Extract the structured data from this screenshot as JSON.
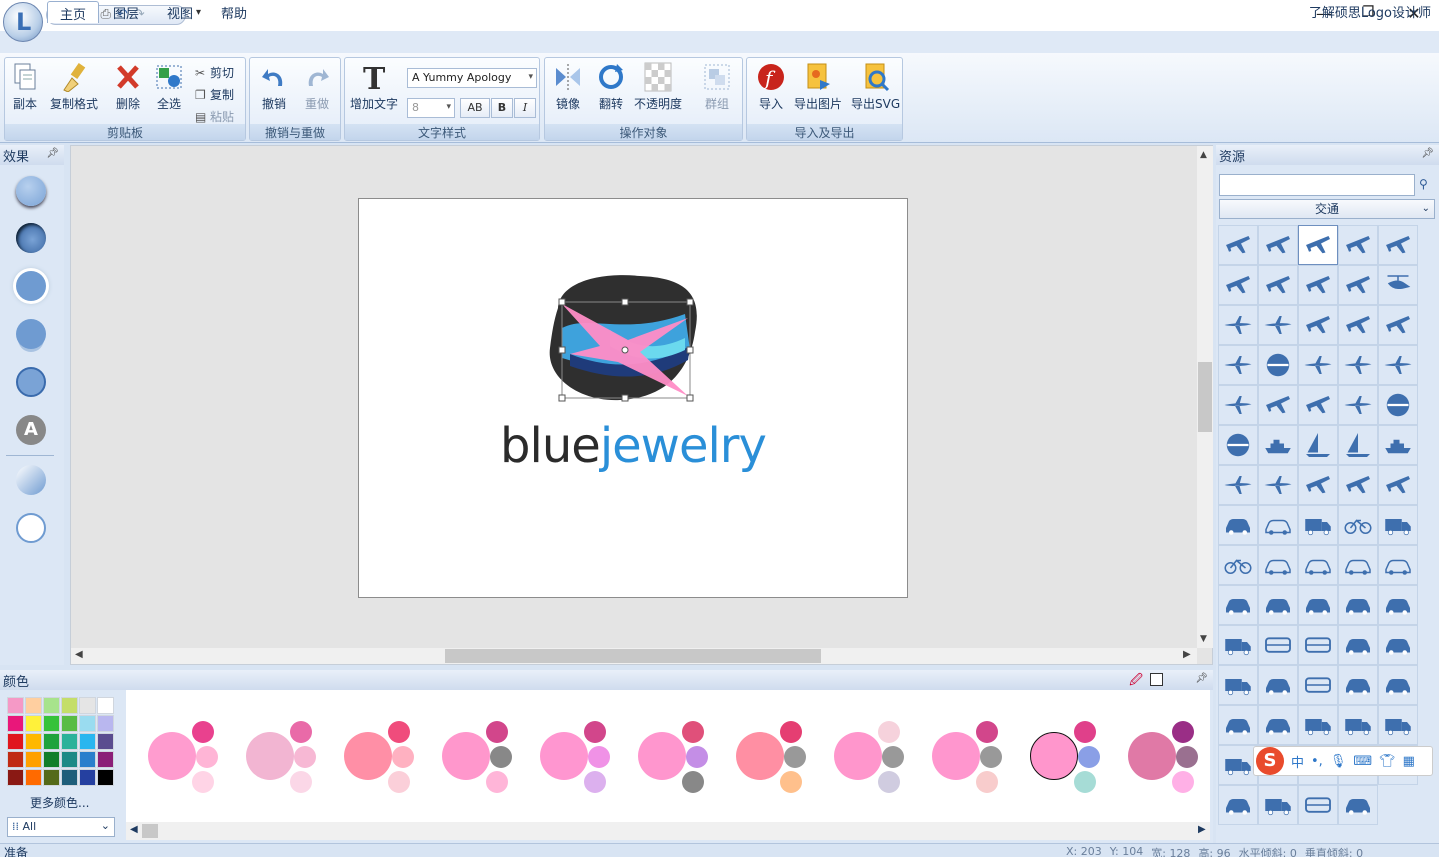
{
  "app": {
    "about_link": "了解硕思Logo设计师"
  },
  "tabs": [
    {
      "label": "主页",
      "active": true
    },
    {
      "label": "图层",
      "active": false
    },
    {
      "label": "视图",
      "active": false
    },
    {
      "label": "帮助",
      "active": false
    }
  ],
  "ribbon": {
    "clipboard": {
      "label": "剪贴板",
      "copy_obj": "副本",
      "format_painter": "复制格式",
      "delete": "删除",
      "select_all": "全选",
      "cut": "剪切",
      "copy": "复制",
      "paste": "粘贴"
    },
    "undo": {
      "label": "撤销与重做",
      "undo": "撤销",
      "redo": "重做"
    },
    "text": {
      "label": "文字样式",
      "add_text": "增加文字",
      "font": "A Yummy Apology",
      "size": "8",
      "bold": "B",
      "italic": "I",
      "spacing": "AB"
    },
    "arrange": {
      "label": "操作对象",
      "mirror": "镜像",
      "flip": "翻转",
      "opacity": "不透明度",
      "group": "群组"
    },
    "io": {
      "label": "导入及导出",
      "import": "导入",
      "export_image": "导出图片",
      "export_svg": "导出SVG"
    }
  },
  "effects_panel": {
    "title": "效果"
  },
  "resources_panel": {
    "title": "资源",
    "search_value": "",
    "category": "交通"
  },
  "colors_panel": {
    "title": "颜色",
    "more_colors": "更多颜色...",
    "filter": "All"
  },
  "logo": {
    "word1": "blue",
    "word2": "jewelry",
    "word1_color": "#2b2b2b",
    "word2_color": "#2a8fd8"
  },
  "status": {
    "text": "准备",
    "x_label": "X:",
    "x": "203",
    "y_label": "Y:",
    "y": "104",
    "w_label": "宽:",
    "w": "128",
    "h_label": "高:",
    "h": "96",
    "hskew_label": "水平倾斜:",
    "hskew": "0",
    "vskew_label": "垂直倾斜:",
    "vskew": "0"
  },
  "ime": {
    "chinese": "中",
    "punct": "•,"
  },
  "colors": {
    "accent": "#3d6db0",
    "pink": "#ff8dc6",
    "icon_blue": "#3e6fae"
  }
}
